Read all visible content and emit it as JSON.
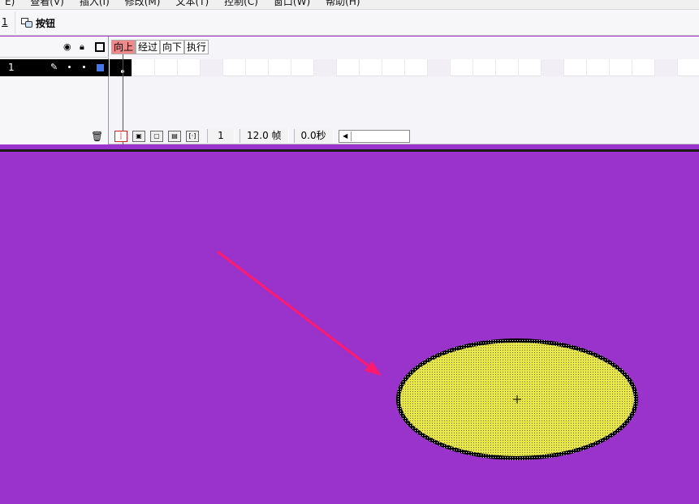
{
  "menu": {
    "items": [
      "E)",
      "查看(V)",
      "插入(I)",
      "修改(M)",
      "文本(T)",
      "控制(C)",
      "窗口(W)",
      "帮助(H)"
    ]
  },
  "editbar": {
    "scene_label": "1",
    "symbol_name": "按钮"
  },
  "timeline": {
    "layer_name": "1",
    "frame_labels": [
      "向上",
      "经过",
      "向下",
      "执行"
    ],
    "active_frame_label": "向上",
    "current_frame": "1",
    "frame_rate": "12.0 帧",
    "elapsed_time": "0.0秒",
    "layer_color": "#4477ee"
  },
  "stage": {
    "background": "#9933cc",
    "shape": "ellipse",
    "fill_color": "#e8e84a",
    "stroke_color": "#000000",
    "arrow_color": "#ff1a6e"
  }
}
